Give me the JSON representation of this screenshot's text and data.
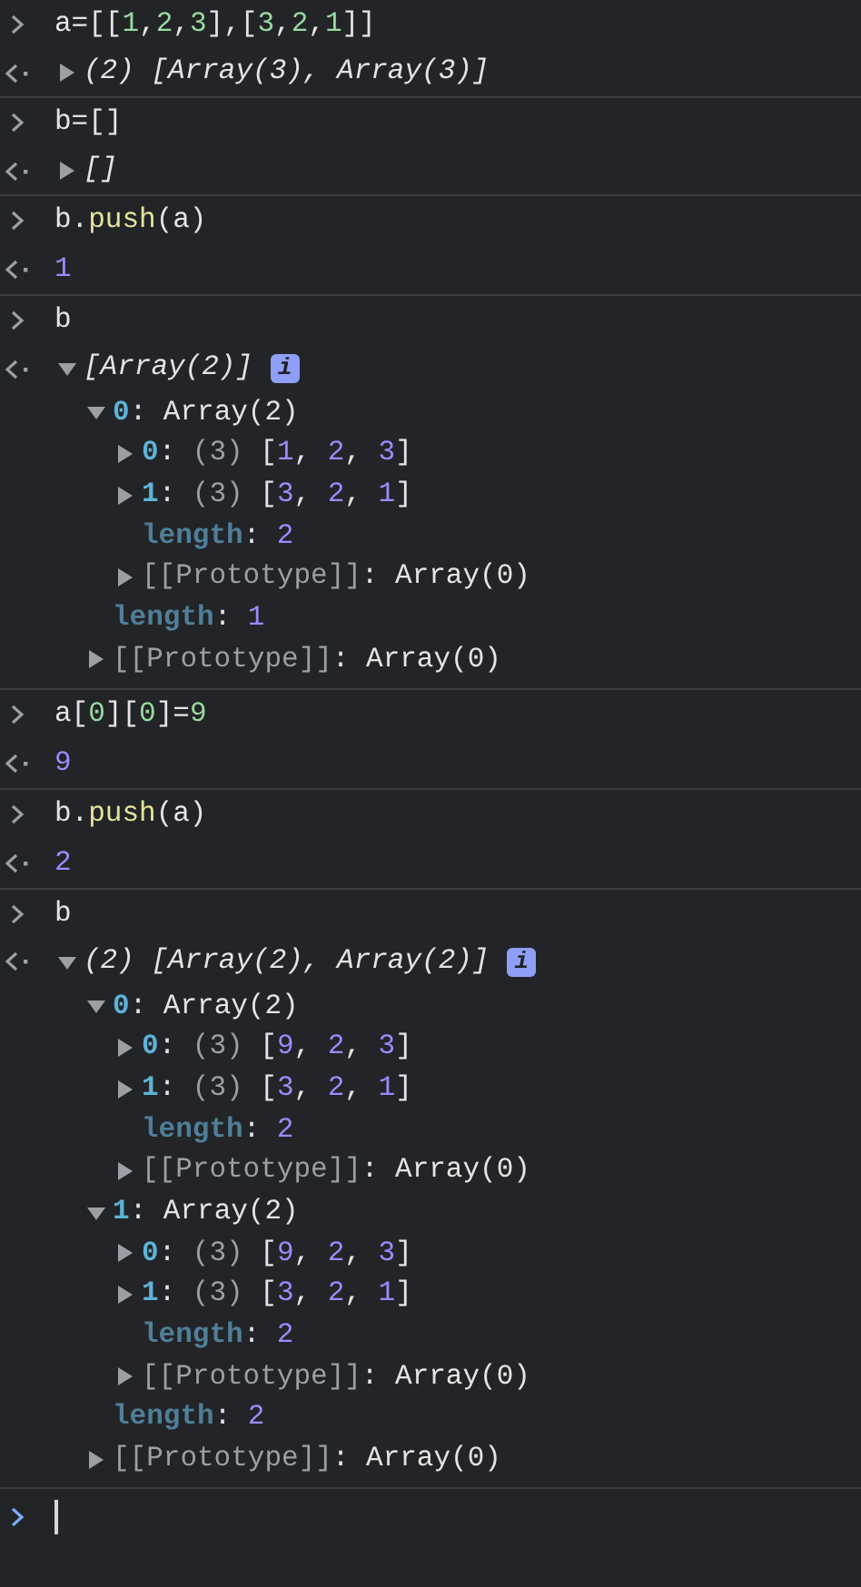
{
  "entries": [
    {
      "input": [
        {
          "kind": "plain",
          "text": "a=[["
        },
        {
          "kind": "number",
          "text": "1"
        },
        {
          "kind": "plain",
          "text": ","
        },
        {
          "kind": "number",
          "text": "2"
        },
        {
          "kind": "plain",
          "text": ","
        },
        {
          "kind": "number",
          "text": "3"
        },
        {
          "kind": "plain",
          "text": "],["
        },
        {
          "kind": "number",
          "text": "3"
        },
        {
          "kind": "plain",
          "text": ","
        },
        {
          "kind": "number",
          "text": "2"
        },
        {
          "kind": "plain",
          "text": ","
        },
        {
          "kind": "number",
          "text": "1"
        },
        {
          "kind": "plain",
          "text": "]]"
        }
      ],
      "output": {
        "kind": "tree",
        "expanded": false,
        "summary": "(2) [Array(3), Array(3)]"
      }
    },
    {
      "input": [
        {
          "kind": "plain",
          "text": "b=[]"
        }
      ],
      "output": {
        "kind": "tree",
        "expanded": false,
        "summary": "[]"
      }
    },
    {
      "input": [
        {
          "kind": "plain",
          "text": "b."
        },
        {
          "kind": "function",
          "text": "push"
        },
        {
          "kind": "plain",
          "text": "(a)"
        }
      ],
      "output": {
        "kind": "value",
        "text": "1"
      }
    },
    {
      "input": [
        {
          "kind": "plain",
          "text": "b"
        }
      ],
      "output": {
        "kind": "tree",
        "expanded": true,
        "summary": "[Array(2)]",
        "badge": "i",
        "children": [
          {
            "kind": "branch",
            "expanded": true,
            "segments": [
              {
                "kind": "index",
                "text": "0"
              },
              {
                "kind": "plain",
                "text": ": Array(2)"
              }
            ],
            "children": [
              {
                "kind": "branch",
                "expanded": false,
                "segments": [
                  {
                    "kind": "index",
                    "text": "0"
                  },
                  {
                    "kind": "plain",
                    "text": ": "
                  },
                  {
                    "kind": "count",
                    "text": "(3)"
                  },
                  {
                    "kind": "plain",
                    "text": " ["
                  },
                  {
                    "kind": "number",
                    "text": "1"
                  },
                  {
                    "kind": "plain",
                    "text": ", "
                  },
                  {
                    "kind": "number",
                    "text": "2"
                  },
                  {
                    "kind": "plain",
                    "text": ", "
                  },
                  {
                    "kind": "number",
                    "text": "3"
                  },
                  {
                    "kind": "plain",
                    "text": "]"
                  }
                ]
              },
              {
                "kind": "branch",
                "expanded": false,
                "segments": [
                  {
                    "kind": "index",
                    "text": "1"
                  },
                  {
                    "kind": "plain",
                    "text": ": "
                  },
                  {
                    "kind": "count",
                    "text": "(3)"
                  },
                  {
                    "kind": "plain",
                    "text": " ["
                  },
                  {
                    "kind": "number",
                    "text": "3"
                  },
                  {
                    "kind": "plain",
                    "text": ", "
                  },
                  {
                    "kind": "number",
                    "text": "2"
                  },
                  {
                    "kind": "plain",
                    "text": ", "
                  },
                  {
                    "kind": "number",
                    "text": "1"
                  },
                  {
                    "kind": "plain",
                    "text": "]"
                  }
                ]
              },
              {
                "kind": "leaf",
                "segments": [
                  {
                    "kind": "hidden",
                    "text": "length"
                  },
                  {
                    "kind": "plain",
                    "text": ": "
                  },
                  {
                    "kind": "number",
                    "text": "2"
                  }
                ]
              },
              {
                "kind": "branch",
                "expanded": false,
                "segments": [
                  {
                    "kind": "internal",
                    "text": "[[Prototype]]"
                  },
                  {
                    "kind": "plain",
                    "text": ": Array(0)"
                  }
                ]
              }
            ]
          },
          {
            "kind": "leaf",
            "segments": [
              {
                "kind": "hidden",
                "text": "length"
              },
              {
                "kind": "plain",
                "text": ": "
              },
              {
                "kind": "number",
                "text": "1"
              }
            ]
          },
          {
            "kind": "branch",
            "expanded": false,
            "segments": [
              {
                "kind": "internal",
                "text": "[[Prototype]]"
              },
              {
                "kind": "plain",
                "text": ": Array(0)"
              }
            ]
          }
        ]
      }
    },
    {
      "input": [
        {
          "kind": "plain",
          "text": "a["
        },
        {
          "kind": "number",
          "text": "0"
        },
        {
          "kind": "plain",
          "text": "]["
        },
        {
          "kind": "number",
          "text": "0"
        },
        {
          "kind": "plain",
          "text": "]="
        },
        {
          "kind": "number",
          "text": "9"
        }
      ],
      "output": {
        "kind": "value",
        "text": "9"
      }
    },
    {
      "input": [
        {
          "kind": "plain",
          "text": "b."
        },
        {
          "kind": "function",
          "text": "push"
        },
        {
          "kind": "plain",
          "text": "(a)"
        }
      ],
      "output": {
        "kind": "value",
        "text": "2"
      }
    },
    {
      "input": [
        {
          "kind": "plain",
          "text": "b"
        }
      ],
      "output": {
        "kind": "tree",
        "expanded": true,
        "summary": "(2) [Array(2), Array(2)]",
        "badge": "i",
        "children": [
          {
            "kind": "branch",
            "expanded": true,
            "segments": [
              {
                "kind": "index",
                "text": "0"
              },
              {
                "kind": "plain",
                "text": ": Array(2)"
              }
            ],
            "children": [
              {
                "kind": "branch",
                "expanded": false,
                "segments": [
                  {
                    "kind": "index",
                    "text": "0"
                  },
                  {
                    "kind": "plain",
                    "text": ": "
                  },
                  {
                    "kind": "count",
                    "text": "(3)"
                  },
                  {
                    "kind": "plain",
                    "text": " ["
                  },
                  {
                    "kind": "number",
                    "text": "9"
                  },
                  {
                    "kind": "plain",
                    "text": ", "
                  },
                  {
                    "kind": "number",
                    "text": "2"
                  },
                  {
                    "kind": "plain",
                    "text": ", "
                  },
                  {
                    "kind": "number",
                    "text": "3"
                  },
                  {
                    "kind": "plain",
                    "text": "]"
                  }
                ]
              },
              {
                "kind": "branch",
                "expanded": false,
                "segments": [
                  {
                    "kind": "index",
                    "text": "1"
                  },
                  {
                    "kind": "plain",
                    "text": ": "
                  },
                  {
                    "kind": "count",
                    "text": "(3)"
                  },
                  {
                    "kind": "plain",
                    "text": " ["
                  },
                  {
                    "kind": "number",
                    "text": "3"
                  },
                  {
                    "kind": "plain",
                    "text": ", "
                  },
                  {
                    "kind": "number",
                    "text": "2"
                  },
                  {
                    "kind": "plain",
                    "text": ", "
                  },
                  {
                    "kind": "number",
                    "text": "1"
                  },
                  {
                    "kind": "plain",
                    "text": "]"
                  }
                ]
              },
              {
                "kind": "leaf",
                "segments": [
                  {
                    "kind": "hidden",
                    "text": "length"
                  },
                  {
                    "kind": "plain",
                    "text": ": "
                  },
                  {
                    "kind": "number",
                    "text": "2"
                  }
                ]
              },
              {
                "kind": "branch",
                "expanded": false,
                "segments": [
                  {
                    "kind": "internal",
                    "text": "[[Prototype]]"
                  },
                  {
                    "kind": "plain",
                    "text": ": Array(0)"
                  }
                ]
              }
            ]
          },
          {
            "kind": "branch",
            "expanded": true,
            "segments": [
              {
                "kind": "index",
                "text": "1"
              },
              {
                "kind": "plain",
                "text": ": Array(2)"
              }
            ],
            "children": [
              {
                "kind": "branch",
                "expanded": false,
                "segments": [
                  {
                    "kind": "index",
                    "text": "0"
                  },
                  {
                    "kind": "plain",
                    "text": ": "
                  },
                  {
                    "kind": "count",
                    "text": "(3)"
                  },
                  {
                    "kind": "plain",
                    "text": " ["
                  },
                  {
                    "kind": "number",
                    "text": "9"
                  },
                  {
                    "kind": "plain",
                    "text": ", "
                  },
                  {
                    "kind": "number",
                    "text": "2"
                  },
                  {
                    "kind": "plain",
                    "text": ", "
                  },
                  {
                    "kind": "number",
                    "text": "3"
                  },
                  {
                    "kind": "plain",
                    "text": "]"
                  }
                ]
              },
              {
                "kind": "branch",
                "expanded": false,
                "segments": [
                  {
                    "kind": "index",
                    "text": "1"
                  },
                  {
                    "kind": "plain",
                    "text": ": "
                  },
                  {
                    "kind": "count",
                    "text": "(3)"
                  },
                  {
                    "kind": "plain",
                    "text": " ["
                  },
                  {
                    "kind": "number",
                    "text": "3"
                  },
                  {
                    "kind": "plain",
                    "text": ", "
                  },
                  {
                    "kind": "number",
                    "text": "2"
                  },
                  {
                    "kind": "plain",
                    "text": ", "
                  },
                  {
                    "kind": "number",
                    "text": "1"
                  },
                  {
                    "kind": "plain",
                    "text": "]"
                  }
                ]
              },
              {
                "kind": "leaf",
                "segments": [
                  {
                    "kind": "hidden",
                    "text": "length"
                  },
                  {
                    "kind": "plain",
                    "text": ": "
                  },
                  {
                    "kind": "number",
                    "text": "2"
                  }
                ]
              },
              {
                "kind": "branch",
                "expanded": false,
                "segments": [
                  {
                    "kind": "internal",
                    "text": "[[Prototype]]"
                  },
                  {
                    "kind": "plain",
                    "text": ": Array(0)"
                  }
                ]
              }
            ]
          },
          {
            "kind": "leaf",
            "segments": [
              {
                "kind": "hidden",
                "text": "length"
              },
              {
                "kind": "plain",
                "text": ": "
              },
              {
                "kind": "number",
                "text": "2"
              }
            ]
          },
          {
            "kind": "branch",
            "expanded": false,
            "segments": [
              {
                "kind": "internal",
                "text": "[[Prototype]]"
              },
              {
                "kind": "plain",
                "text": ": Array(0)"
              }
            ]
          }
        ]
      }
    }
  ],
  "prompt": {
    "focused": true
  }
}
